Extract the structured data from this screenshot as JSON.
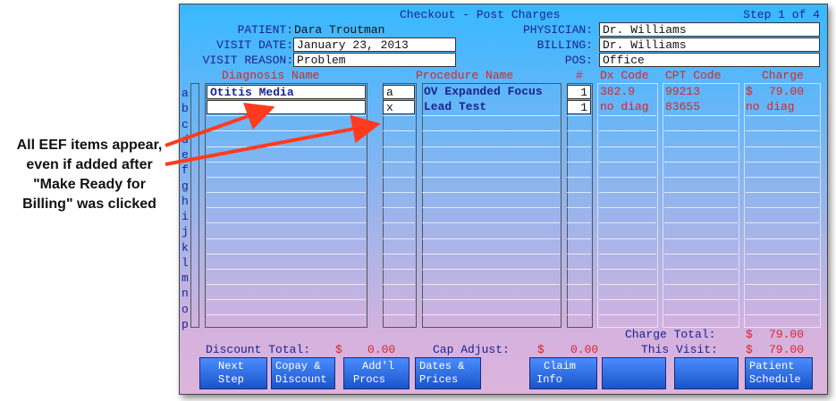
{
  "callout": {
    "line1": "All EEF items appear,",
    "line2": "even if added after",
    "line3": "\"Make Ready for",
    "line4": "Billing\" was clicked"
  },
  "window": {
    "title": "Checkout - Post Charges",
    "step": "Step 1 of 4"
  },
  "header": {
    "patient_label": "PATIENT:",
    "patient_value": "Dara Troutman",
    "visit_date_label": "VISIT DATE:",
    "visit_date_value": "January 23, 2013",
    "visit_reason_label": "VISIT REASON:",
    "visit_reason_value": "Problem",
    "physician_label": "PHYSICIAN:",
    "physician_value": "Dr. Williams",
    "billing_label": "BILLING:",
    "billing_value": "Dr. Williams",
    "pos_label": "POS:",
    "pos_value": "Office"
  },
  "columns": {
    "diagnosis": "Diagnosis Name",
    "procedure": "Procedure Name",
    "count": "#",
    "dx": "Dx Code",
    "cpt": "CPT Code",
    "charge": "Charge"
  },
  "row_letters": [
    "a",
    "b",
    "c",
    "d",
    "e",
    "f",
    "g",
    "h",
    "i",
    "j",
    "k",
    "l",
    "m",
    "n",
    "o",
    "p"
  ],
  "diagnoses": [
    "Otitis Media",
    ""
  ],
  "procedures": [
    {
      "ref": "a",
      "name": "OV Expanded Focus",
      "count": "1",
      "dx": "382.9",
      "cpt": "99213",
      "charge_sym": "$",
      "charge": "79.00"
    },
    {
      "ref": "x",
      "name": "Lead Test",
      "count": "1",
      "dx": "no diag",
      "cpt": "83655",
      "charge_sym": "",
      "charge": "no diag"
    }
  ],
  "totals": {
    "charge_total_label": "Charge Total:",
    "charge_total_sym": "$",
    "charge_total": "79.00",
    "this_visit_label": "This Visit:",
    "this_visit_sym": "$",
    "this_visit": "79.00",
    "discount_label": "Discount Total:",
    "discount_sym": "$",
    "discount": "0.00",
    "cap_label": "Cap Adjust:",
    "cap_sym": "$",
    "cap": "0.00"
  },
  "buttons": {
    "next_1": "Next",
    "next_2": "Step",
    "copay_1": "Copay &",
    "copay_2": "Discount",
    "addl_1": "Add'l",
    "addl_2": "Procs",
    "dates_1": "Dates &",
    "dates_2": "Prices",
    "claim_1": "Claim",
    "claim_2": "Info",
    "sched_1": "Patient",
    "sched_2": "Schedule"
  },
  "colors": {
    "accent_red": "#d8242c",
    "label_navy": "#1a2390",
    "button_blue": "#2a6ae0"
  }
}
